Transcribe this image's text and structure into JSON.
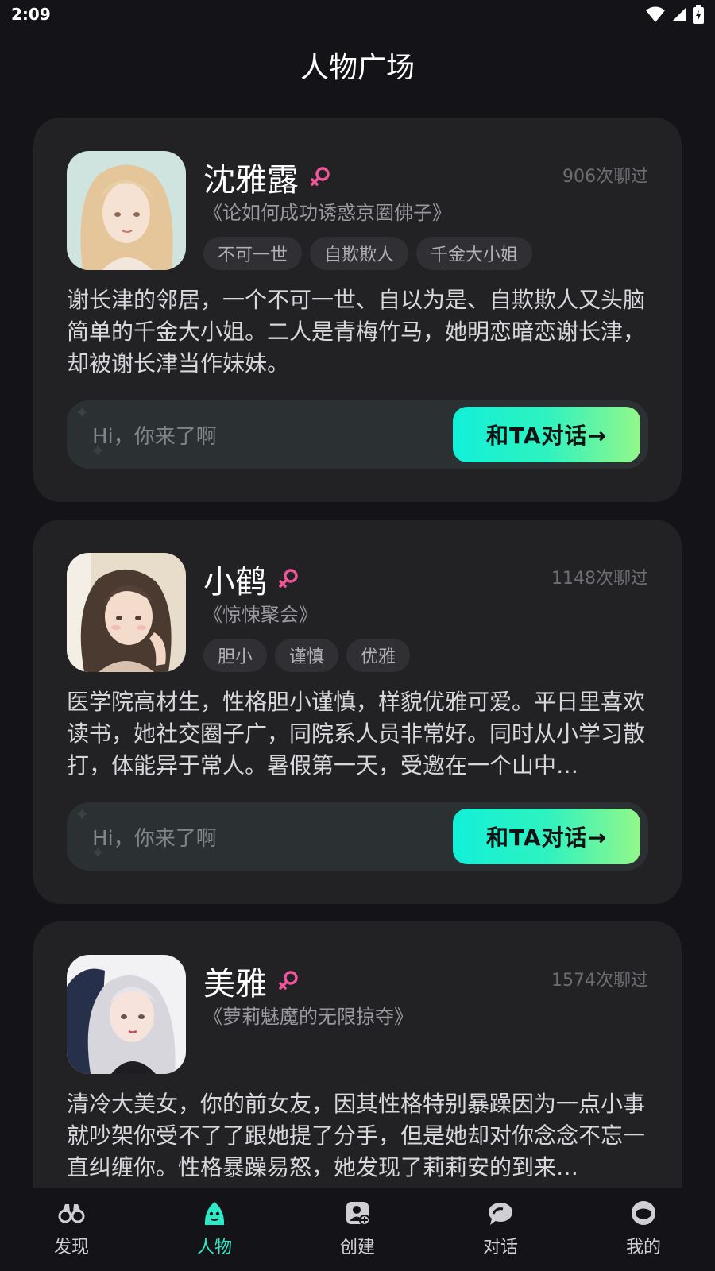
{
  "status_bar": {
    "time": "2:09"
  },
  "page_title": "人物广场",
  "characters": [
    {
      "name": "沈雅露",
      "chat_count": "906次聊过",
      "story": "《论如何成功诱惑京圈佛子》",
      "tags": [
        "不可一世",
        "自欺欺人",
        "千金大小姐"
      ],
      "description": "谢长津的邻居，一个不可一世、自以为是、自欺欺人又头脑简单的千金大小姐。二人是青梅竹马，她明恋暗恋谢长津，却被谢长津当作妹妹。",
      "chat_placeholder": "Hi，你来了啊",
      "chat_button": "和TA对话→"
    },
    {
      "name": "小鹤",
      "chat_count": "1148次聊过",
      "story": "《惊悚聚会》",
      "tags": [
        "胆小",
        "谨慎",
        "优雅"
      ],
      "description": "医学院高材生，性格胆小谨慎，样貌优雅可爱。平日里喜欢读书，她社交圈子广，同院系人员非常好。同时从小学习散打，体能异于常人。暑假第一天，受邀在一个山中…",
      "chat_placeholder": "Hi，你来了啊",
      "chat_button": "和TA对话→"
    },
    {
      "name": "美雅",
      "chat_count": "1574次聊过",
      "story": "《萝莉魅魔的无限掠夺》",
      "tags": [],
      "description": "清冷大美女，你的前女友，因其性格特别暴躁因为一点小事就吵架你受不了了跟她提了分手，但是她却对你念念不忘一直纠缠你。性格暴躁易怒，她发现了莉莉安的到来…"
    }
  ],
  "bottom_nav": [
    {
      "label": "发现",
      "icon": "binoculars-icon"
    },
    {
      "label": "人物",
      "icon": "character-face-icon",
      "active": true
    },
    {
      "label": "创建",
      "icon": "create-person-icon"
    },
    {
      "label": "对话",
      "icon": "chat-bubble-icon"
    },
    {
      "label": "我的",
      "icon": "profile-icon"
    }
  ],
  "colors": {
    "background": "#141418",
    "card": "#222225",
    "accent": "#2ee8c8",
    "female_icon": "#f0559a",
    "button_gradient_start": "#12f0d8",
    "button_gradient_end": "#93f78a"
  }
}
